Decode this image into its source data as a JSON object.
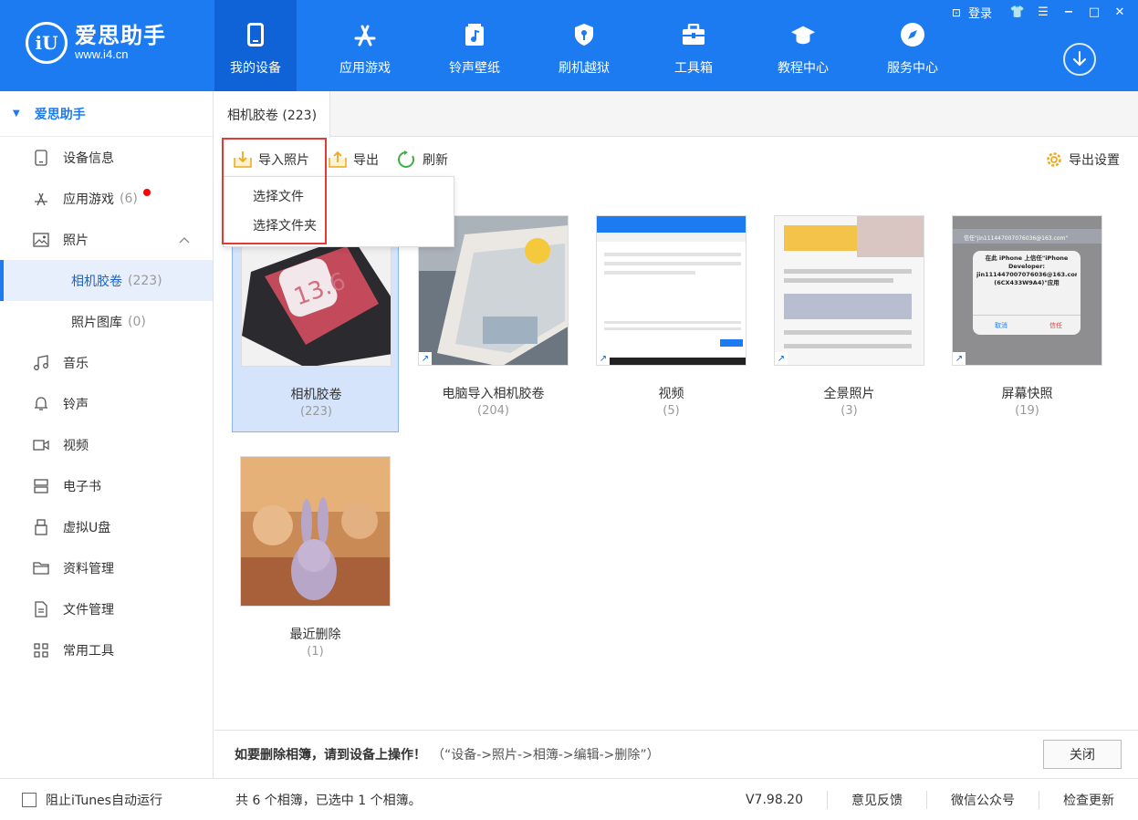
{
  "header": {
    "logo_mark": "iU",
    "logo_name": "爱思助手",
    "logo_url": "www.i4.cn",
    "login": "登录",
    "nav": [
      {
        "label": "我的设备",
        "icon": "phone-icon",
        "active": true
      },
      {
        "label": "应用游戏",
        "icon": "app-store-icon"
      },
      {
        "label": "铃声壁纸",
        "icon": "music-file-icon"
      },
      {
        "label": "刷机越狱",
        "icon": "shield-key-icon"
      },
      {
        "label": "工具箱",
        "icon": "toolbox-icon"
      },
      {
        "label": "教程中心",
        "icon": "graduation-cap-icon"
      },
      {
        "label": "服务中心",
        "icon": "compass-icon"
      }
    ]
  },
  "sidebar": {
    "title": "爱思助手",
    "items": [
      {
        "label": "设备信息",
        "icon": "device-info-icon"
      },
      {
        "label": "应用游戏",
        "count": "(6)",
        "icon": "app-icon",
        "badge": true
      },
      {
        "label": "照片",
        "icon": "photo-icon",
        "expanded": true
      },
      {
        "label": "相机胶卷",
        "count": "(223)",
        "sub": true,
        "active": true
      },
      {
        "label": "照片图库",
        "count": "(0)",
        "sub": true
      },
      {
        "label": "音乐",
        "icon": "music-icon"
      },
      {
        "label": "铃声",
        "icon": "bell-icon"
      },
      {
        "label": "视频",
        "icon": "video-icon"
      },
      {
        "label": "电子书",
        "icon": "ebook-icon"
      },
      {
        "label": "虚拟U盘",
        "icon": "usb-icon"
      },
      {
        "label": "资料管理",
        "icon": "folder-icon"
      },
      {
        "label": "文件管理",
        "icon": "file-icon"
      },
      {
        "label": "常用工具",
        "icon": "grid-icon"
      }
    ]
  },
  "tabs": {
    "active": "相机胶卷 (223)"
  },
  "toolbar": {
    "import": "导入照片",
    "export": "导出",
    "refresh": "刷新",
    "export_settings": "导出设置"
  },
  "dropdown": {
    "items": [
      "选择文件",
      "选择文件夹"
    ]
  },
  "albums": [
    {
      "name": "相机胶卷",
      "count": "(223)",
      "selected": true
    },
    {
      "name": "电脑导入相机胶卷",
      "count": "(204)"
    },
    {
      "name": "视频",
      "count": "(5)"
    },
    {
      "name": "全景照片",
      "count": "(3)"
    },
    {
      "name": "屏幕快照",
      "count": "(19)"
    },
    {
      "name": "最近删除",
      "count": "(1)"
    }
  ],
  "thumb_text": {
    "ios": "13.6",
    "trust_title": "信任\"jin111447007076036@163.com\"",
    "trust_body": "在此 iPhone 上信任\"iPhone Developer: jin111447007076036@163.com (6CX433W9A4)\"应用",
    "trust_cancel": "取消",
    "trust_ok": "信任"
  },
  "note": {
    "bold": "如要删除相簿，请到设备上操作！",
    "path": "（“设备->照片->相簿->编辑->删除”）",
    "close": "关闭"
  },
  "status": {
    "itunes_checkbox": "阻止iTunes自动运行",
    "summary": "共 6 个相簿，已选中 1 个相簿。",
    "version": "V7.98.20",
    "feedback": "意见反馈",
    "wechat": "微信公众号",
    "update": "检查更新"
  },
  "colors": {
    "brand": "#1d7bf2",
    "brand_active": "#0f63d6",
    "highlight": "#e53935",
    "badge": "#ff0000"
  }
}
